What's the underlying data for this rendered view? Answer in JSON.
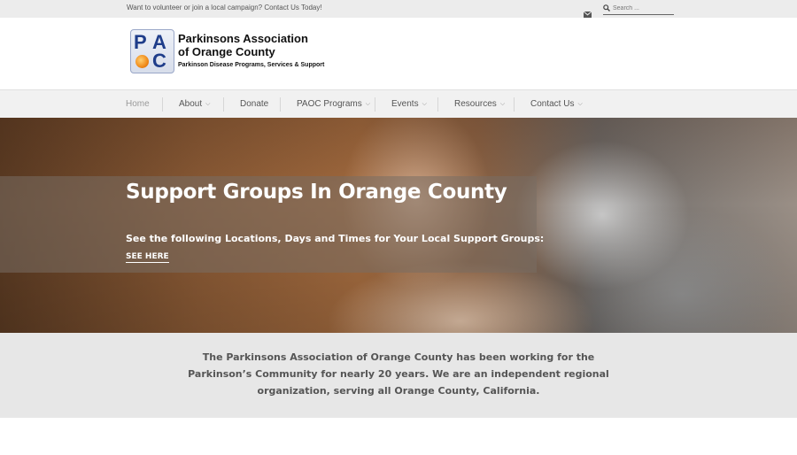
{
  "topbar": {
    "message": "Want to volunteer or join a local campaign? Contact Us Today!",
    "search_placeholder": "Search ...",
    "mail_icon": "envelope-icon",
    "search_icon": "magnifier-icon"
  },
  "logo": {
    "letters": [
      "P",
      "A",
      "C"
    ],
    "line1": "Parkinsons Association",
    "line2": "of Orange County",
    "tagline": "Parkinson Disease Programs, Services & Support",
    "colors": {
      "letters": "#1f3d8a",
      "dot": "#f08a1a"
    }
  },
  "nav": {
    "items": [
      {
        "label": "Home",
        "dropdown": false,
        "active": true
      },
      {
        "label": "About",
        "dropdown": true
      },
      {
        "label": "Donate",
        "dropdown": false
      },
      {
        "label": "PAOC Programs",
        "dropdown": true
      },
      {
        "label": "Events",
        "dropdown": true
      },
      {
        "label": "Resources",
        "dropdown": true
      },
      {
        "label": "Contact Us",
        "dropdown": true
      }
    ],
    "chevron": "⌄"
  },
  "hero": {
    "title": "Support Groups In Orange County",
    "subtitle": "See the following Locations, Days and Times for Your Local Support Groups:",
    "link_label": "SEE HERE"
  },
  "intro": {
    "text": "The Parkinsons Association of Orange County has been working for the Parkinson’s Community for nearly 20 years. We are an independent regional organization, serving all Orange County, California."
  }
}
